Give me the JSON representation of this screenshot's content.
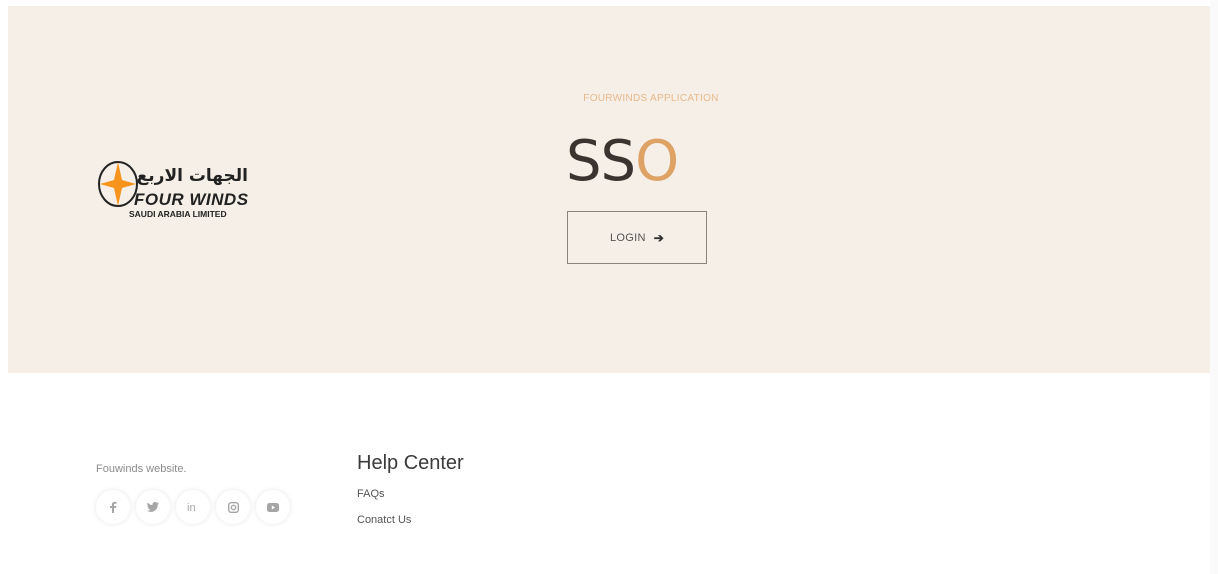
{
  "hero": {
    "logo": {
      "arabic_text": "الجهات الاربع",
      "english_text": "FOUR WINDS",
      "subtitle": "SAUDI ARABIA LIMITED",
      "accent_color": "#f7941d"
    },
    "app_label": "FOURWINDS APPLICATION",
    "title_main": "SS",
    "title_accent": "O",
    "login_label": "LOGIN",
    "login_icon": "arrow-right-icon"
  },
  "footer": {
    "site_label": "Fouwinds website.",
    "social_icons": [
      "facebook-icon",
      "twitter-icon",
      "linkedin-icon",
      "instagram-icon",
      "youtube-icon"
    ],
    "help_title": "Help Center",
    "links": {
      "faqs": "FAQs",
      "contact": "Conatct Us"
    }
  },
  "colors": {
    "hero_bg": "#f5efe7",
    "accent": "#dda264",
    "label": "#e8b98b",
    "text_dark": "#3b3330"
  }
}
